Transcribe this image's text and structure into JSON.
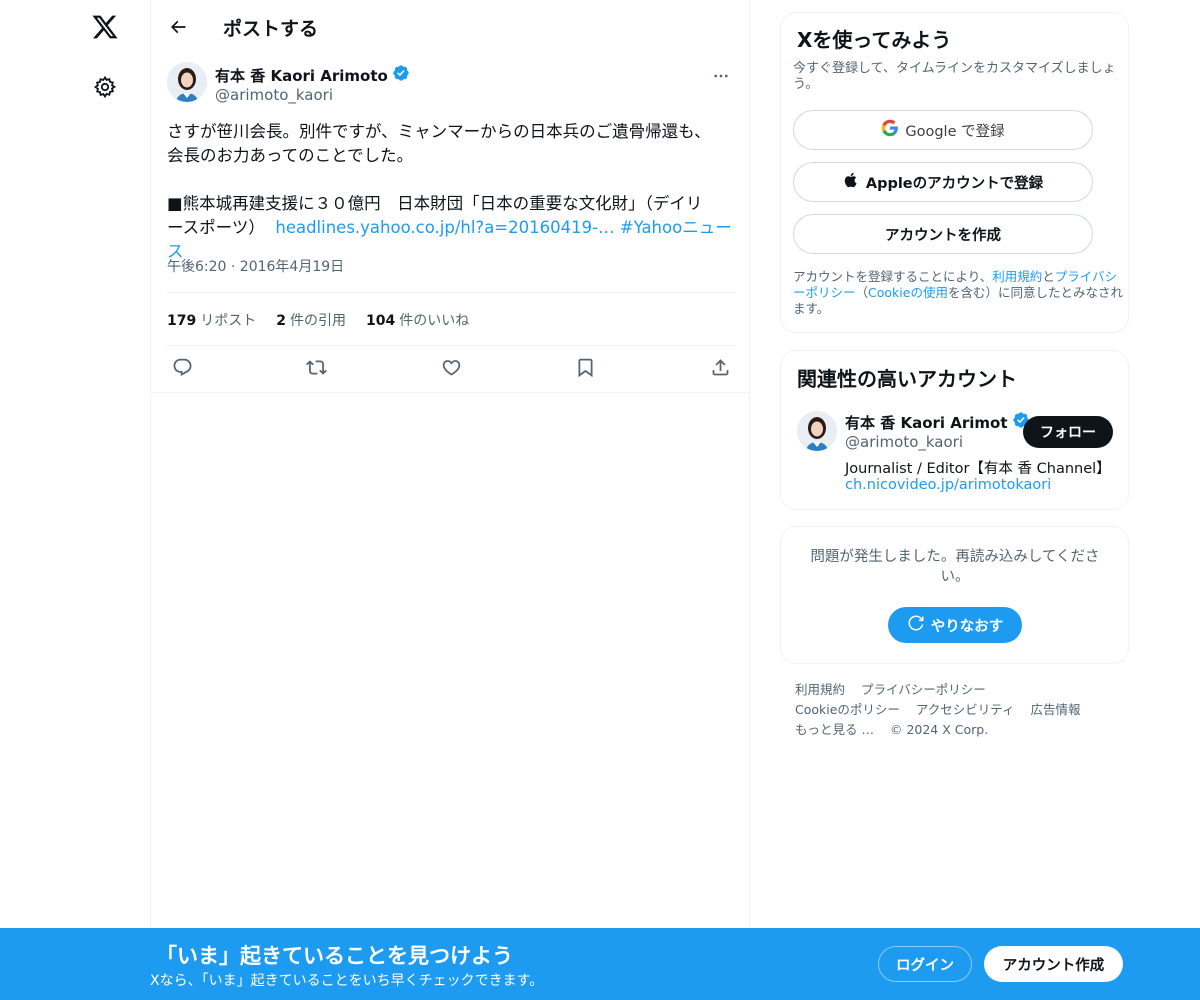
{
  "header": {
    "title": "ポストする"
  },
  "tweet": {
    "author_name": "有本 香 Kaori Arimoto",
    "author_handle": "@arimoto_kaori",
    "text_line1": "さすが笹川会長。別件ですが、ミャンマーからの日本兵のご遺骨帰還も、",
    "text_line2": "会長のお力あってのことでした。",
    "text_line3": "■熊本城再建支援に３０億円　日本財団「日本の重要な文化財」（デイリ",
    "text_line4": "ースポーツ）",
    "link_url": "headlines.yahoo.co.jp/hl?a=20160419-…",
    "hashtag": "#Yahooニュース",
    "timestamp": "午後6:20 · 2016年4月19日",
    "stats": {
      "reposts_count": "179",
      "reposts_label": "リポスト",
      "quotes_count": "2",
      "quotes_label": "件の引用",
      "likes_count": "104",
      "likes_label": "件のいいね"
    }
  },
  "signup": {
    "title": "Xを使ってみよう",
    "desc": "今すぐ登録して、タイムラインをカスタマイズしましょう。",
    "google_label": "Google で登録",
    "apple_label": "Appleのアカウントで登録",
    "create_label": "アカウントを作成",
    "legal_pre": "アカウントを登録することにより、",
    "legal_terms": "利用規約",
    "legal_and": "と",
    "legal_privacy": "プライバシーポリシー",
    "legal_paren_open": "（",
    "legal_cookie": "Cookieの使用",
    "legal_post": "を含む）に同意したとみなされます。"
  },
  "related": {
    "title": "関連性の高いアカウント",
    "name": "有本 香 Kaori Arimot",
    "handle": "@arimoto_kaori",
    "follow_label": "フォロー",
    "bio": "Journalist / Editor【有本 香 Channel】",
    "link": "ch.nicovideo.jp/arimotokaori"
  },
  "error": {
    "text": "問題が発生しました。再読み込みしてください。",
    "retry_label": "やりなおす"
  },
  "footer": {
    "terms": "利用規約",
    "privacy": "プライバシーポリシー",
    "cookie": "Cookieのポリシー",
    "accessibility": "アクセシビリティ",
    "ads": "広告情報",
    "more": "もっと見る …",
    "copyright": "© 2024 X Corp."
  },
  "banner": {
    "title": "「いま」起きていることを見つけよう",
    "subtitle": "Xなら、「いま」起きていることをいち早くチェックできます。",
    "login_label": "ログイン",
    "create_label": "アカウント作成"
  },
  "colors": {
    "accent": "#1d9bf0",
    "text": "#0f1419",
    "secondary": "#536471"
  },
  "icons": [
    "x-logo-icon",
    "gear-icon",
    "back-arrow-icon",
    "verified-badge-icon",
    "more-icon",
    "reply-icon",
    "repost-icon",
    "like-icon",
    "bookmark-icon",
    "share-icon",
    "google-icon",
    "apple-icon",
    "refresh-icon"
  ]
}
